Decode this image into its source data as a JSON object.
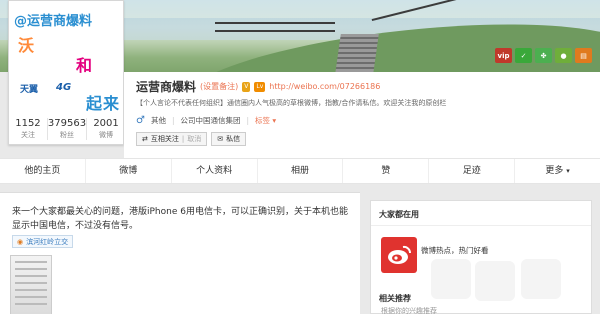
{
  "cover": {
    "top_icons": [
      {
        "name": "vip-icon",
        "text": "vip",
        "color": "#c0392b"
      },
      {
        "name": "wechat-icon",
        "text": "✓",
        "color": "#3aa83a"
      },
      {
        "name": "app-icon",
        "text": "✤",
        "color": "#4caf50"
      },
      {
        "name": "android-icon",
        "text": "●",
        "color": "#6fae3a"
      },
      {
        "name": "card-icon",
        "text": "▤",
        "color": "#e07a1e"
      }
    ]
  },
  "avatar": {
    "line1": "@运营商爆料",
    "wo": "沃",
    "he": "和",
    "tianyi": "天翼",
    "fourg": "4G",
    "qilai": "起来"
  },
  "stats": [
    {
      "value": "1152",
      "label": "关注"
    },
    {
      "value": "379563",
      "label": "粉丝"
    },
    {
      "value": "2001",
      "label": "微博"
    }
  ],
  "profile": {
    "name": "运营商爆料",
    "remark": "(设置备注)",
    "url": "http://weibo.com/07266186",
    "intro": "【个人言论不代表任何组织】通信圈内人气极高的草根微博，指教/合作请私信。欢迎关注我的原创栏",
    "gender_icon": "♂",
    "location": "其他",
    "company": "公司中国通信集团",
    "tag": "标签",
    "follow_btn": "互相关注",
    "cancel_btn": "取消",
    "message_btn": "私信"
  },
  "nav": [
    "他的主页",
    "微博",
    "个人资料",
    "相册",
    "赞",
    "足迹",
    "更多"
  ],
  "post": {
    "text": "来一个大家都最关心的问题，港版iPhone 6用电信卡，可以正确识别，关于本机也能显示中国电信，不过没有信号。",
    "location": "滨河红岭立交"
  },
  "sidebar": {
    "title": "大家都在用",
    "app_label": "微博热点，热门好看",
    "title2": "相关推荐",
    "sub": "根据你的兴趣推荐"
  }
}
